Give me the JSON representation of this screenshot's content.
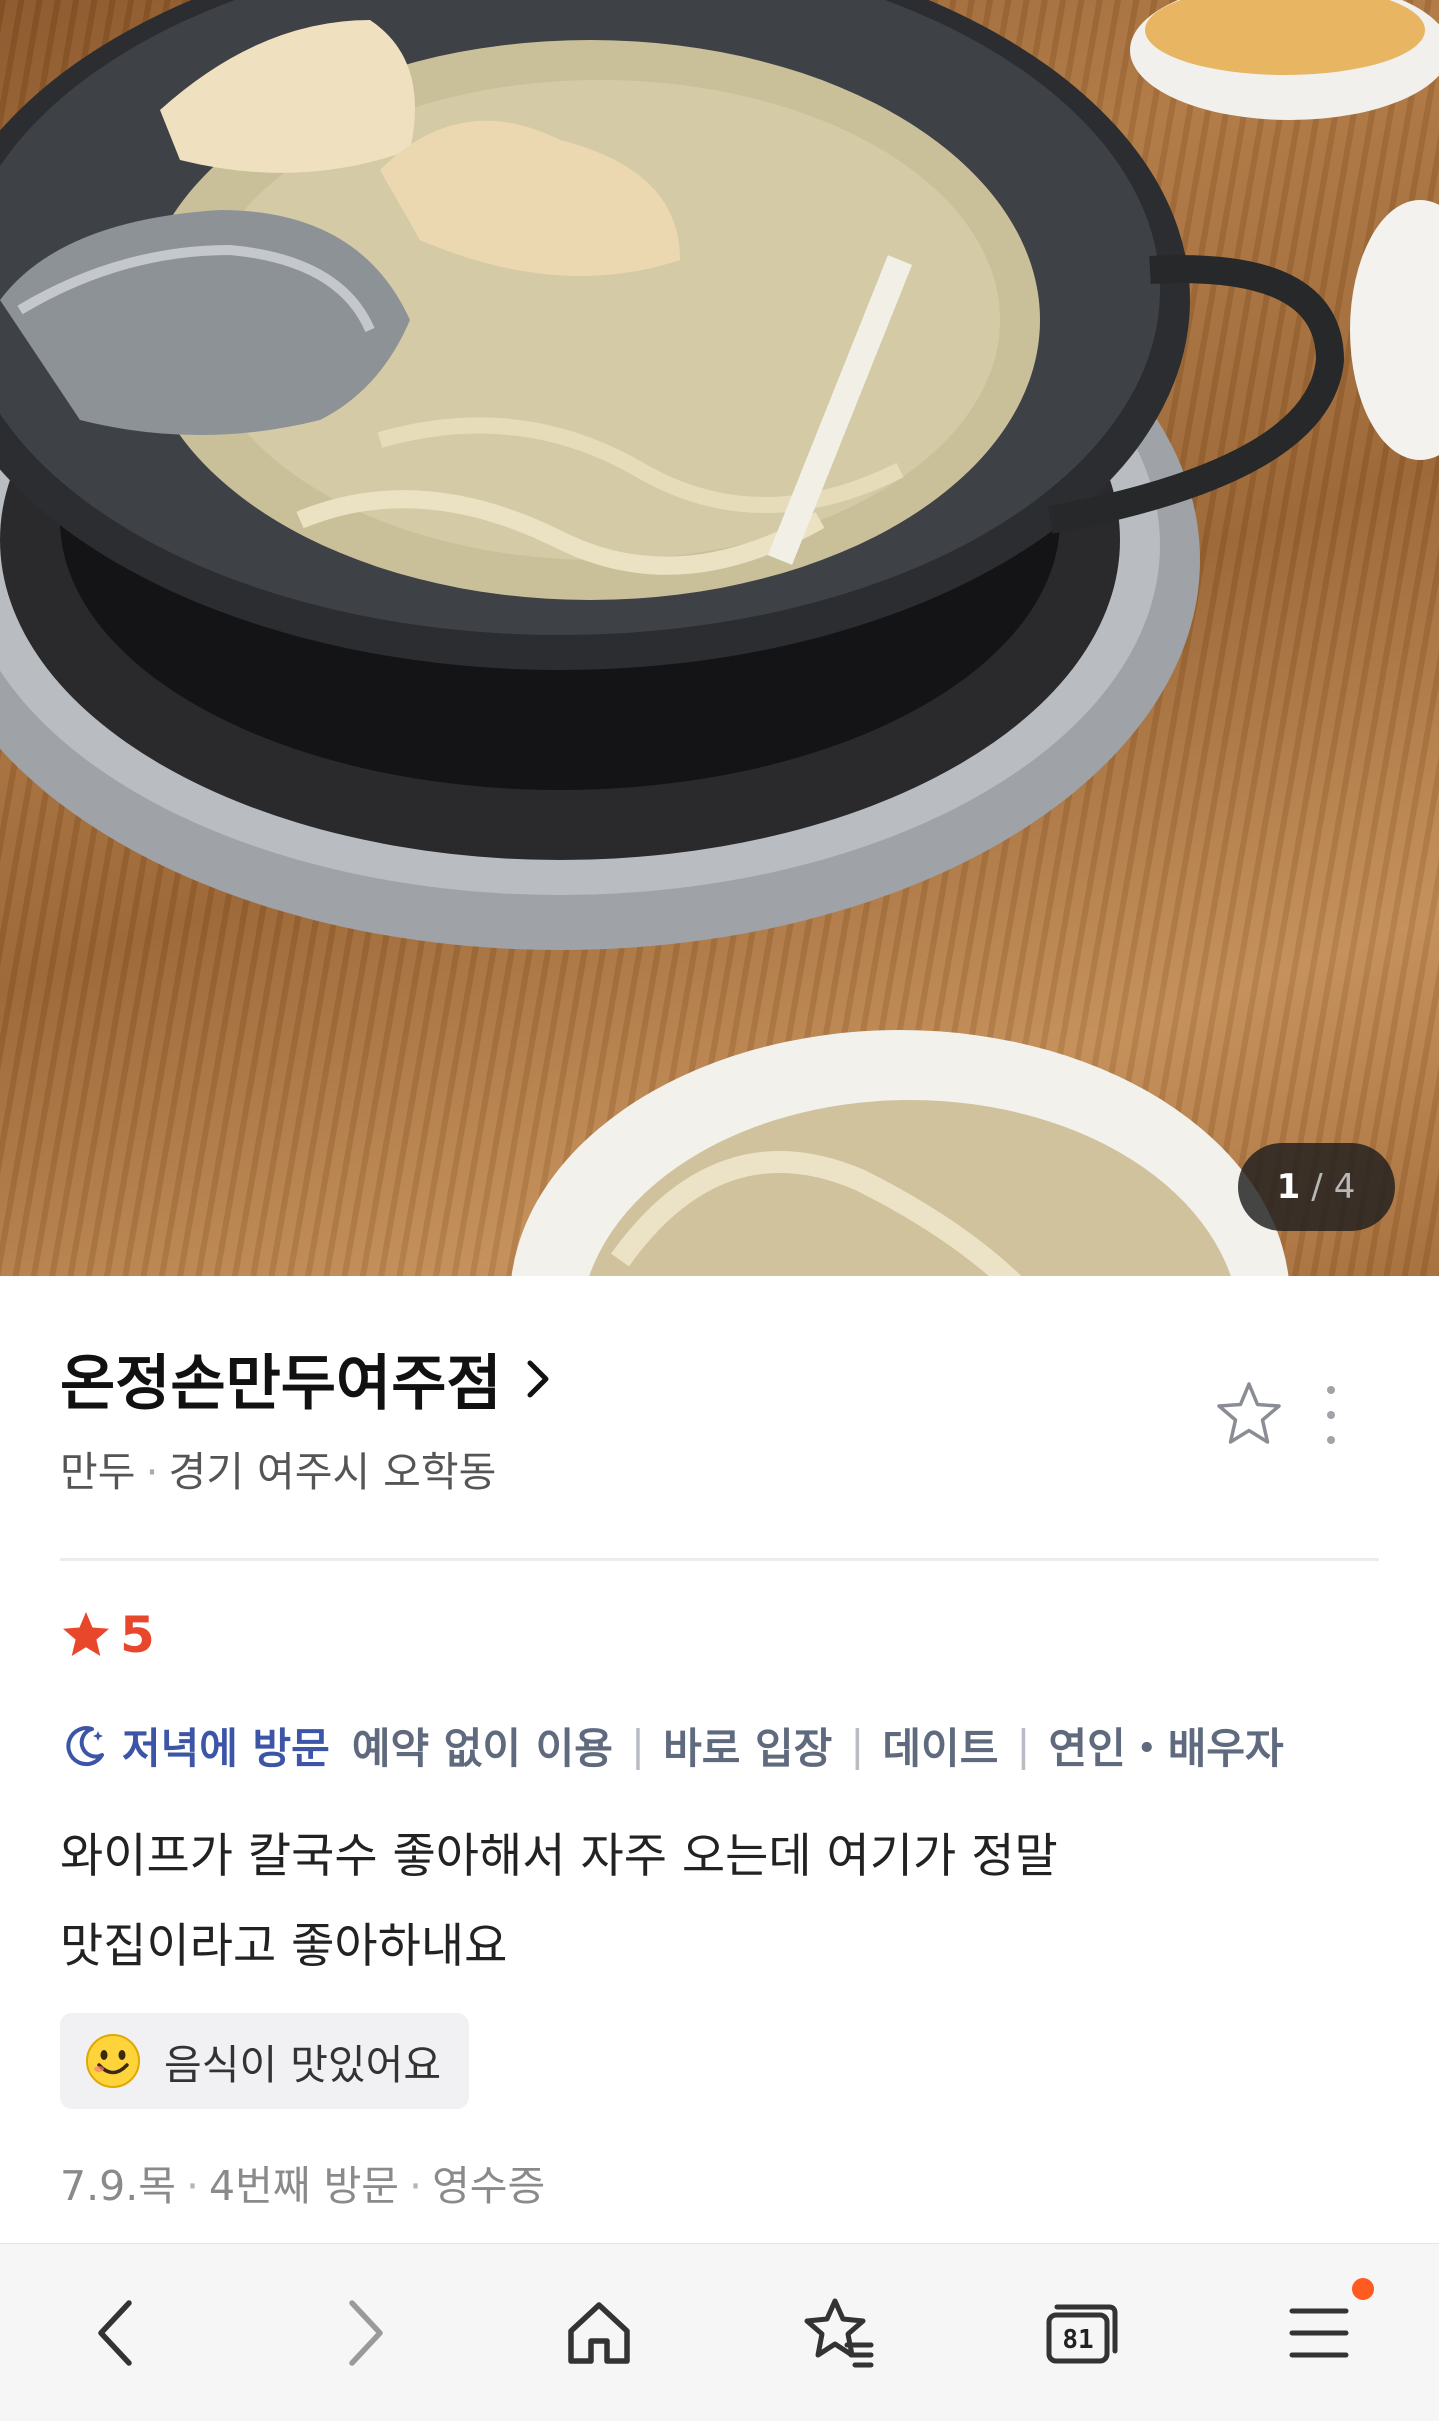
{
  "photo": {
    "counter": {
      "current": "1",
      "separator": "/",
      "total": "4"
    }
  },
  "place": {
    "name": "온정손만두여주점",
    "category": "만두",
    "location": "경기 여주시 오학동"
  },
  "review": {
    "rating": "5",
    "visit_time": "저녁에 방문",
    "tags": [
      "예약 없이 이용",
      "바로 입장",
      "데이트",
      "연인・배우자"
    ],
    "text_lines": [
      "와이프가 칼국수 좋아해서 자주 오는데 여기가 정말",
      "맛집이라고 좋아하내요"
    ],
    "keyword_chip": "음식이 맛있어요",
    "visit_date": "7.9.목",
    "visit_count": "4번째 방문",
    "verification": "영수증"
  },
  "toolbar": {
    "tab_count": "81"
  },
  "colors": {
    "rating_star": "#e8472b",
    "visit_time_text": "#3d55a6",
    "tag_text": "#606a7e",
    "menu_notification_dot": "#ff5a1f"
  },
  "icons": {
    "photo_counter": "none",
    "place_chevron": "chevron-right-icon",
    "favorite": "star-outline-icon",
    "more": "more-vertical-icon",
    "rating": "star-filled-icon",
    "visit_time": "moon-icon",
    "keyword": "smile-emoji-icon",
    "toolbar": [
      "back-icon",
      "forward-icon",
      "home-icon",
      "bookmark-star-icon",
      "tabs-icon",
      "menu-icon"
    ]
  }
}
